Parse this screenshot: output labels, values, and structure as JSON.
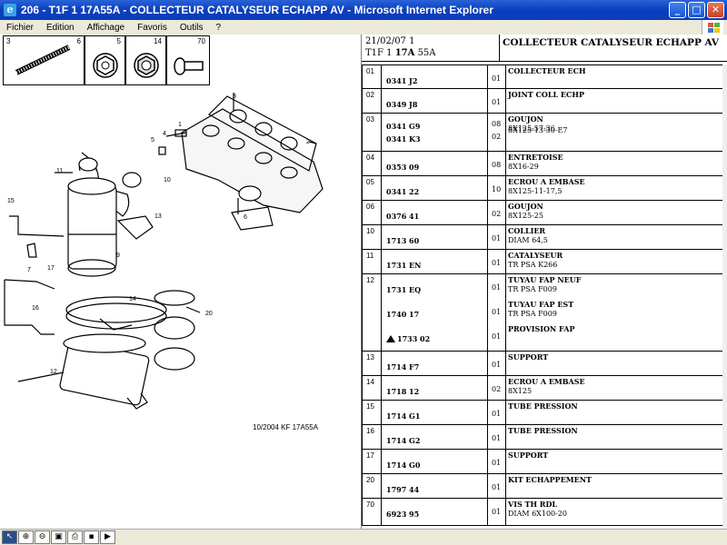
{
  "window": {
    "title": "206 - T1F 1 17A55A - COLLECTEUR CATALYSEUR ECHAPP AV - Microsoft Internet Explorer",
    "min": "_",
    "max": "□",
    "close": "✕"
  },
  "menu": [
    "Fichier",
    "Edition",
    "Affichage",
    "Favoris",
    "Outils",
    "?"
  ],
  "thumbs": [
    {
      "a": "3",
      "b": "6"
    },
    {
      "a": "5"
    },
    {
      "a": "14"
    },
    {
      "a": "70"
    }
  ],
  "diagram": {
    "caption": "10/2004   KF 17A55A",
    "callouts": [
      "3",
      "2",
      "1",
      "4",
      "5",
      "11",
      "10",
      "13",
      "15",
      "16",
      "17",
      "6",
      "9",
      "7",
      "14",
      "20",
      "12"
    ]
  },
  "header": {
    "date": "21/02/07 1",
    "ref_prefix": "T1F 1 ",
    "ref_bold": "17A",
    "ref_suffix": " 55A",
    "title": "COLLECTEUR CATALYSEUR ECHAPP AV"
  },
  "rows": [
    {
      "no": "01",
      "lines": [
        {
          "ref": "0341 J2",
          "qty": "01",
          "d1": "COLLECTEUR ECH",
          "d2": ""
        }
      ]
    },
    {
      "no": "02",
      "lines": [
        {
          "ref": "0349 J8",
          "qty": "01",
          "d1": "JOINT COLL ECHP",
          "d2": ""
        }
      ]
    },
    {
      "no": "03",
      "lines": [
        {
          "ref": "0341 G9",
          "qty": "08",
          "d1": "GOUJON",
          "d2": "8X125-57-36"
        },
        {
          "ref": "0341 K3",
          "qty": "02",
          "d1": "",
          "d2": "8X125-13-30-E7"
        }
      ]
    },
    {
      "no": "04",
      "lines": [
        {
          "ref": "0353 09",
          "qty": "08",
          "d1": "ENTRETOISE",
          "d2": "8X16-29"
        }
      ]
    },
    {
      "no": "05",
      "lines": [
        {
          "ref": "0341 22",
          "qty": "10",
          "d1": "ECROU A EMBASE",
          "d2": "8X125-11-17,5"
        }
      ]
    },
    {
      "no": "06",
      "lines": [
        {
          "ref": "0376 41",
          "qty": "02",
          "d1": "GOUJON",
          "d2": "8X125-25"
        }
      ]
    },
    {
      "no": "10",
      "lines": [
        {
          "ref": "1713 60",
          "qty": "01",
          "d1": "COLLIER",
          "d2": "DIAM 64,5"
        }
      ]
    },
    {
      "no": "11",
      "lines": [
        {
          "ref": "1731 EN",
          "qty": "01",
          "d1": "CATALYSEUR",
          "d2": "TR PSA K266"
        }
      ]
    },
    {
      "no": "12",
      "lines": [
        {
          "ref": "1731 EQ",
          "qty": "01",
          "d1": "TUYAU FAP NEUF",
          "d2": "TR PSA F009"
        },
        {
          "ref": "1740 17",
          "qty": "01",
          "d1": "TUYAU FAP EST",
          "d2": "TR PSA F009"
        },
        {
          "ref": "1733 02",
          "qty": "01",
          "d1": "PROVISION FAP",
          "d2": "",
          "tri": true
        }
      ]
    },
    {
      "no": "13",
      "lines": [
        {
          "ref": "1714 F7",
          "qty": "01",
          "d1": "SUPPORT",
          "d2": ""
        }
      ]
    },
    {
      "no": "14",
      "lines": [
        {
          "ref": "1718 12",
          "qty": "02",
          "d1": "ECROU A EMBASE",
          "d2": "8X125"
        }
      ]
    },
    {
      "no": "15",
      "lines": [
        {
          "ref": "1714 G1",
          "qty": "01",
          "d1": "TUBE PRESSION",
          "d2": ""
        }
      ]
    },
    {
      "no": "16",
      "lines": [
        {
          "ref": "1714 G2",
          "qty": "01",
          "d1": "TUBE PRESSION",
          "d2": ""
        }
      ]
    },
    {
      "no": "17",
      "lines": [
        {
          "ref": "1714 G0",
          "qty": "01",
          "d1": "SUPPORT",
          "d2": ""
        }
      ]
    },
    {
      "no": "20",
      "lines": [
        {
          "ref": "1797 44",
          "qty": "01",
          "d1": "KIT ECHAPPEMENT",
          "d2": ""
        }
      ]
    },
    {
      "no": "70",
      "lines": [
        {
          "ref": "6923 95",
          "qty": "01",
          "d1": "VIS TH RDL",
          "d2": "DIAM 6X100-20"
        }
      ]
    }
  ],
  "toolbar": [
    {
      "icon": "pointer-icon",
      "glyph": "↖"
    },
    {
      "icon": "zoom-in-icon",
      "glyph": "⊕"
    },
    {
      "icon": "zoom-out-icon",
      "glyph": "⊖"
    },
    {
      "icon": "fit-page-icon",
      "glyph": "▣"
    },
    {
      "icon": "print-icon",
      "glyph": "⎙"
    },
    {
      "icon": "save-icon",
      "glyph": "▪"
    },
    {
      "icon": "play-icon",
      "glyph": "▶"
    }
  ]
}
